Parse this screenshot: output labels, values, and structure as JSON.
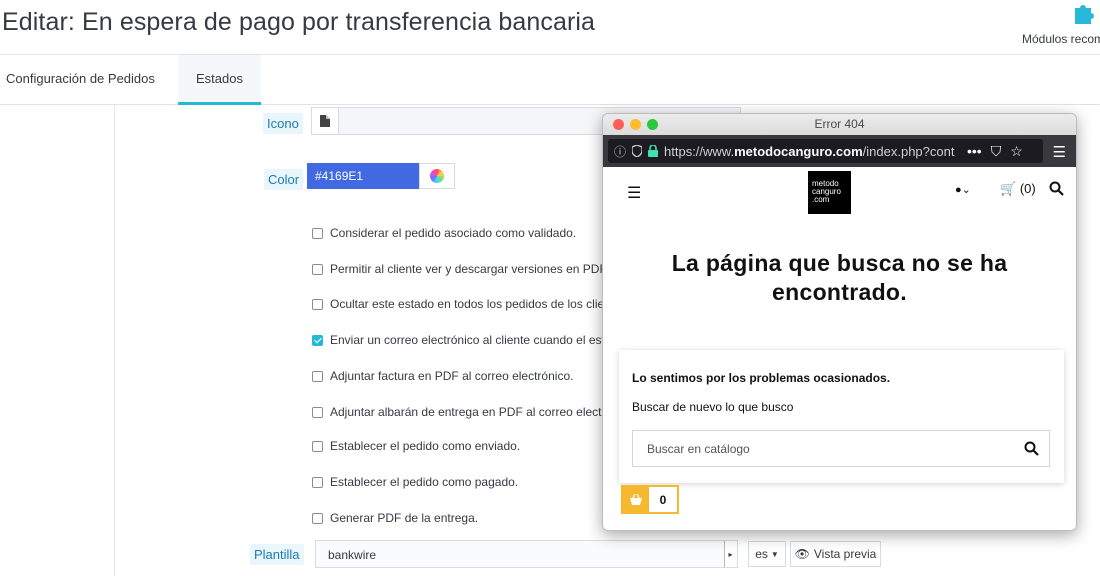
{
  "header": {
    "title": "Editar: En espera de pago por transferencia bancaria",
    "modules_label": "Módulos recom"
  },
  "tabs": [
    {
      "label": "Configuración de Pedidos",
      "active": false
    },
    {
      "label": "Estados",
      "active": true
    }
  ],
  "form": {
    "icon_label": "Icono",
    "color_label": "Color",
    "color_value": "#4169E1",
    "checkboxes": [
      {
        "label": "Considerar el pedido asociado como validado.",
        "checked": false
      },
      {
        "label": "Permitir al cliente ver y descargar versiones en PDF de",
        "checked": false
      },
      {
        "label": "Ocultar este estado en todos los pedidos de los cliente",
        "checked": false
      },
      {
        "label": "Enviar un correo electrónico al cliente cuando el estad",
        "checked": true
      },
      {
        "label": "Adjuntar factura en PDF al correo electrónico.",
        "checked": false
      },
      {
        "label": "Adjuntar albarán de entrega en PDF al correo electrón",
        "checked": false
      },
      {
        "label": "Establecer el pedido como enviado.",
        "checked": false
      },
      {
        "label": "Establecer el pedido como pagado.",
        "checked": false
      },
      {
        "label": "Generar PDF de la entrega.",
        "checked": false
      }
    ],
    "template_label": "Plantilla",
    "template_value": "bankwire",
    "lang_value": "es",
    "preview_label": "Vista previa"
  },
  "browser": {
    "title": "Error 404",
    "url_prefix": "https://www.",
    "url_domain": "metodocanguro.com",
    "url_rest": "/index.php?cont",
    "site": {
      "logo_lines": [
        "metodo",
        "canguro",
        ".com"
      ],
      "cart_label": "(0)",
      "notfound_text": "La página que busca no se ha encontrado.",
      "sorry_text": "Lo sentimos por los problemas ocasionados.",
      "search_again_text": "Buscar de nuevo lo que busco",
      "search_placeholder": "Buscar en catálogo",
      "cart_count": "0"
    }
  },
  "colors": {
    "accent": "#25b9d7",
    "color_swatch": "#4169e1",
    "cart_badge": "#f5b82e"
  }
}
